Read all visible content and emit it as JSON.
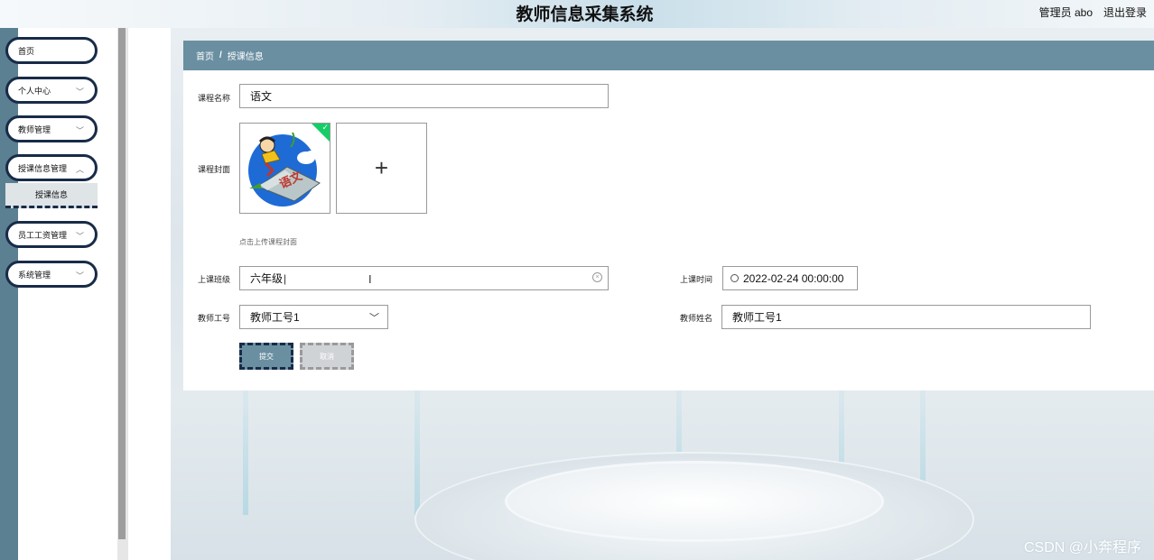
{
  "header": {
    "title": "教师信息采集系统",
    "user": "管理员 abo",
    "logout": "退出登录"
  },
  "sidebar": {
    "items": [
      {
        "label": "首页",
        "has_chevron": false
      },
      {
        "label": "个人中心",
        "has_chevron": true
      },
      {
        "label": "教师管理",
        "has_chevron": true
      },
      {
        "label": "授课信息管理",
        "has_chevron": true
      },
      {
        "label": "员工工资管理",
        "has_chevron": true
      },
      {
        "label": "系统管理",
        "has_chevron": true
      }
    ],
    "submenu_active": "授课信息"
  },
  "breadcrumb": {
    "home": "首页",
    "separator": "/",
    "current": "授课信息"
  },
  "form": {
    "course_name": {
      "label": "课程名称",
      "value": "语文"
    },
    "course_cover": {
      "label": "课程封面",
      "hint": "点击上传课程封面",
      "image_text": "语文"
    },
    "class": {
      "label": "上课班级",
      "value": "六年级"
    },
    "time": {
      "label": "上课时间",
      "value": "2022-02-24 00:00:00"
    },
    "teacher_id": {
      "label": "教师工号",
      "value": "教师工号1"
    },
    "teacher_name": {
      "label": "教师姓名",
      "value": "教师工号1"
    },
    "submit": "提交",
    "cancel": "取消"
  },
  "icons": {
    "add": "+",
    "chevron": "﹀",
    "check": "✓",
    "clear": "×"
  },
  "colors": {
    "accent": "#6a8fa1",
    "sidebar_border": "#182b48",
    "left_strip": "#5a8091",
    "success": "#13ce66"
  },
  "watermark": "CSDN @小奔程序"
}
